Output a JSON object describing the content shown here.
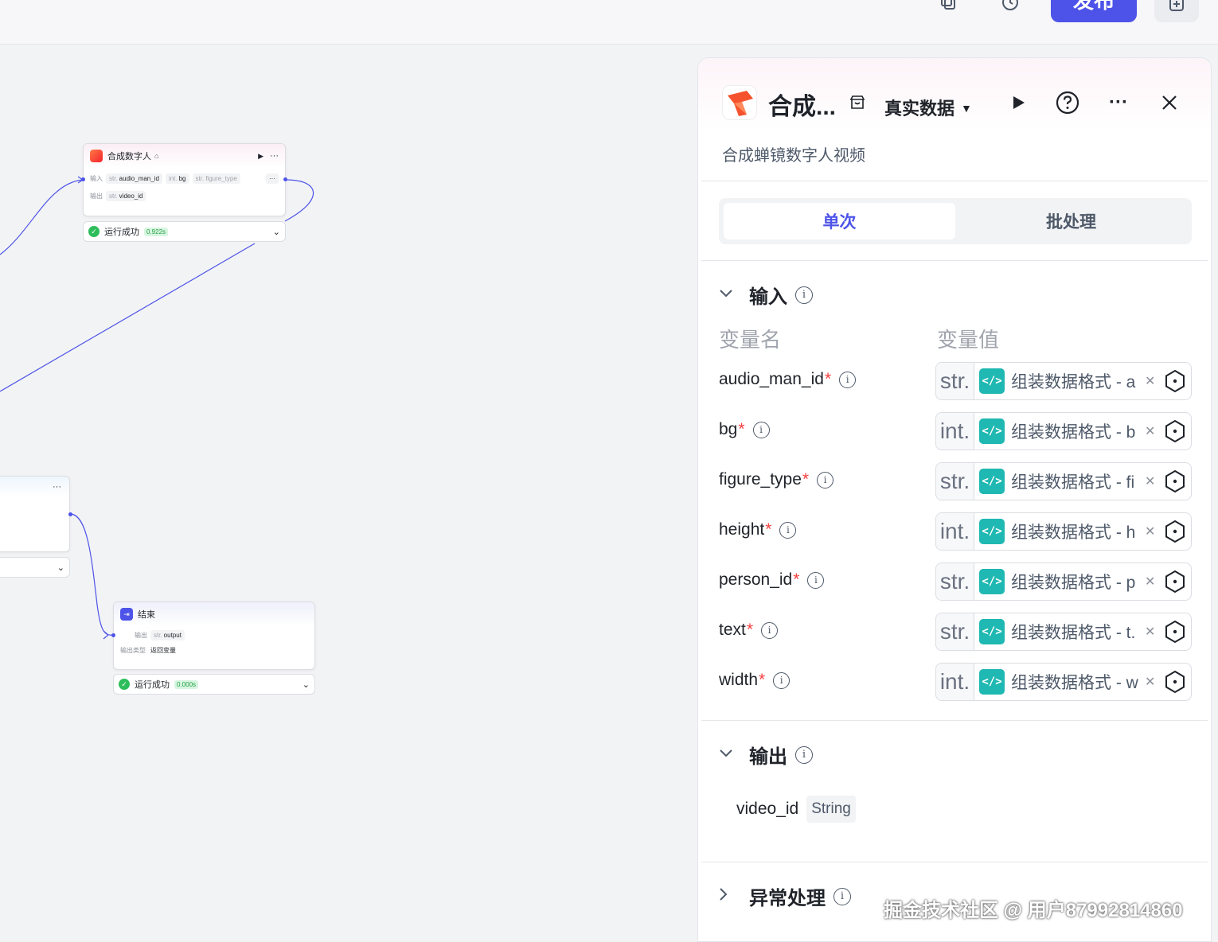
{
  "topbar": {
    "publish_label": "发布",
    "icons": [
      "copy-icon",
      "history-icon",
      "add-icon"
    ]
  },
  "canvas": {
    "node_main": {
      "title": "合成数字人",
      "input_label": "输入",
      "output_label": "输出",
      "inputs": [
        {
          "type": "str.",
          "name": "audio_man_id"
        },
        {
          "type": "int.",
          "name": "bg"
        },
        {
          "type": "str.",
          "name": "figure_type"
        }
      ],
      "more": "···",
      "outputs": [
        {
          "type": "str.",
          "name": "video_id"
        }
      ],
      "status": "运行成功",
      "time": "0.922s"
    },
    "node_left": {
      "more": "···"
    },
    "node_end": {
      "title": "结束",
      "output_label": "输出",
      "output_type_label": "输出类型",
      "outputs": [
        {
          "type": "str.",
          "name": "output"
        }
      ],
      "output_type_value": "返回变量",
      "status": "运行成功",
      "time": "0.000s"
    }
  },
  "panel": {
    "title": "合成...",
    "mode": "真实数据",
    "description": "合成蝉镜数字人视频",
    "tabs": [
      {
        "label": "单次",
        "active": true
      },
      {
        "label": "批处理",
        "active": false
      }
    ],
    "input_section": "输入",
    "col_name": "变量名",
    "col_value": "变量值",
    "variables": [
      {
        "name": "audio_man_id",
        "type": "str.",
        "value": "组装数据格式 - a"
      },
      {
        "name": "bg",
        "type": "int.",
        "value": "组装数据格式 - b"
      },
      {
        "name": "figure_type",
        "type": "str.",
        "value": "组装数据格式 - fi"
      },
      {
        "name": "height",
        "type": "int.",
        "value": "组装数据格式 - h"
      },
      {
        "name": "person_id",
        "type": "str.",
        "value": "组装数据格式 - p"
      },
      {
        "name": "text",
        "type": "str.",
        "value": "组装数据格式 - t."
      },
      {
        "name": "width",
        "type": "int.",
        "value": "组装数据格式 - w"
      }
    ],
    "required_mark": "*",
    "output_section": "输出",
    "output": {
      "name": "video_id",
      "type": "String"
    },
    "error_section": "异常处理"
  },
  "watermark": "掘金技术社区 @ 用户87992814860",
  "colors": {
    "accent": "#4d53e8",
    "success": "#2ebd5c",
    "code": "#1fb8b2",
    "required": "#f53f3f"
  }
}
